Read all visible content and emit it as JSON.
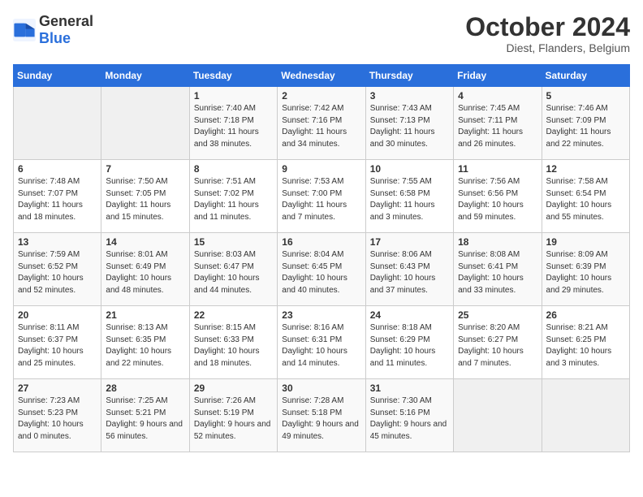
{
  "header": {
    "logo_general": "General",
    "logo_blue": "Blue",
    "month_year": "October 2024",
    "location": "Diest, Flanders, Belgium"
  },
  "days_of_week": [
    "Sunday",
    "Monday",
    "Tuesday",
    "Wednesday",
    "Thursday",
    "Friday",
    "Saturday"
  ],
  "weeks": [
    [
      {
        "day": "",
        "info": ""
      },
      {
        "day": "",
        "info": ""
      },
      {
        "day": "1",
        "info": "Sunrise: 7:40 AM\nSunset: 7:18 PM\nDaylight: 11 hours and 38 minutes."
      },
      {
        "day": "2",
        "info": "Sunrise: 7:42 AM\nSunset: 7:16 PM\nDaylight: 11 hours and 34 minutes."
      },
      {
        "day": "3",
        "info": "Sunrise: 7:43 AM\nSunset: 7:13 PM\nDaylight: 11 hours and 30 minutes."
      },
      {
        "day": "4",
        "info": "Sunrise: 7:45 AM\nSunset: 7:11 PM\nDaylight: 11 hours and 26 minutes."
      },
      {
        "day": "5",
        "info": "Sunrise: 7:46 AM\nSunset: 7:09 PM\nDaylight: 11 hours and 22 minutes."
      }
    ],
    [
      {
        "day": "6",
        "info": "Sunrise: 7:48 AM\nSunset: 7:07 PM\nDaylight: 11 hours and 18 minutes."
      },
      {
        "day": "7",
        "info": "Sunrise: 7:50 AM\nSunset: 7:05 PM\nDaylight: 11 hours and 15 minutes."
      },
      {
        "day": "8",
        "info": "Sunrise: 7:51 AM\nSunset: 7:02 PM\nDaylight: 11 hours and 11 minutes."
      },
      {
        "day": "9",
        "info": "Sunrise: 7:53 AM\nSunset: 7:00 PM\nDaylight: 11 hours and 7 minutes."
      },
      {
        "day": "10",
        "info": "Sunrise: 7:55 AM\nSunset: 6:58 PM\nDaylight: 11 hours and 3 minutes."
      },
      {
        "day": "11",
        "info": "Sunrise: 7:56 AM\nSunset: 6:56 PM\nDaylight: 10 hours and 59 minutes."
      },
      {
        "day": "12",
        "info": "Sunrise: 7:58 AM\nSunset: 6:54 PM\nDaylight: 10 hours and 55 minutes."
      }
    ],
    [
      {
        "day": "13",
        "info": "Sunrise: 7:59 AM\nSunset: 6:52 PM\nDaylight: 10 hours and 52 minutes."
      },
      {
        "day": "14",
        "info": "Sunrise: 8:01 AM\nSunset: 6:49 PM\nDaylight: 10 hours and 48 minutes."
      },
      {
        "day": "15",
        "info": "Sunrise: 8:03 AM\nSunset: 6:47 PM\nDaylight: 10 hours and 44 minutes."
      },
      {
        "day": "16",
        "info": "Sunrise: 8:04 AM\nSunset: 6:45 PM\nDaylight: 10 hours and 40 minutes."
      },
      {
        "day": "17",
        "info": "Sunrise: 8:06 AM\nSunset: 6:43 PM\nDaylight: 10 hours and 37 minutes."
      },
      {
        "day": "18",
        "info": "Sunrise: 8:08 AM\nSunset: 6:41 PM\nDaylight: 10 hours and 33 minutes."
      },
      {
        "day": "19",
        "info": "Sunrise: 8:09 AM\nSunset: 6:39 PM\nDaylight: 10 hours and 29 minutes."
      }
    ],
    [
      {
        "day": "20",
        "info": "Sunrise: 8:11 AM\nSunset: 6:37 PM\nDaylight: 10 hours and 25 minutes."
      },
      {
        "day": "21",
        "info": "Sunrise: 8:13 AM\nSunset: 6:35 PM\nDaylight: 10 hours and 22 minutes."
      },
      {
        "day": "22",
        "info": "Sunrise: 8:15 AM\nSunset: 6:33 PM\nDaylight: 10 hours and 18 minutes."
      },
      {
        "day": "23",
        "info": "Sunrise: 8:16 AM\nSunset: 6:31 PM\nDaylight: 10 hours and 14 minutes."
      },
      {
        "day": "24",
        "info": "Sunrise: 8:18 AM\nSunset: 6:29 PM\nDaylight: 10 hours and 11 minutes."
      },
      {
        "day": "25",
        "info": "Sunrise: 8:20 AM\nSunset: 6:27 PM\nDaylight: 10 hours and 7 minutes."
      },
      {
        "day": "26",
        "info": "Sunrise: 8:21 AM\nSunset: 6:25 PM\nDaylight: 10 hours and 3 minutes."
      }
    ],
    [
      {
        "day": "27",
        "info": "Sunrise: 7:23 AM\nSunset: 5:23 PM\nDaylight: 10 hours and 0 minutes."
      },
      {
        "day": "28",
        "info": "Sunrise: 7:25 AM\nSunset: 5:21 PM\nDaylight: 9 hours and 56 minutes."
      },
      {
        "day": "29",
        "info": "Sunrise: 7:26 AM\nSunset: 5:19 PM\nDaylight: 9 hours and 52 minutes."
      },
      {
        "day": "30",
        "info": "Sunrise: 7:28 AM\nSunset: 5:18 PM\nDaylight: 9 hours and 49 minutes."
      },
      {
        "day": "31",
        "info": "Sunrise: 7:30 AM\nSunset: 5:16 PM\nDaylight: 9 hours and 45 minutes."
      },
      {
        "day": "",
        "info": ""
      },
      {
        "day": "",
        "info": ""
      }
    ]
  ]
}
